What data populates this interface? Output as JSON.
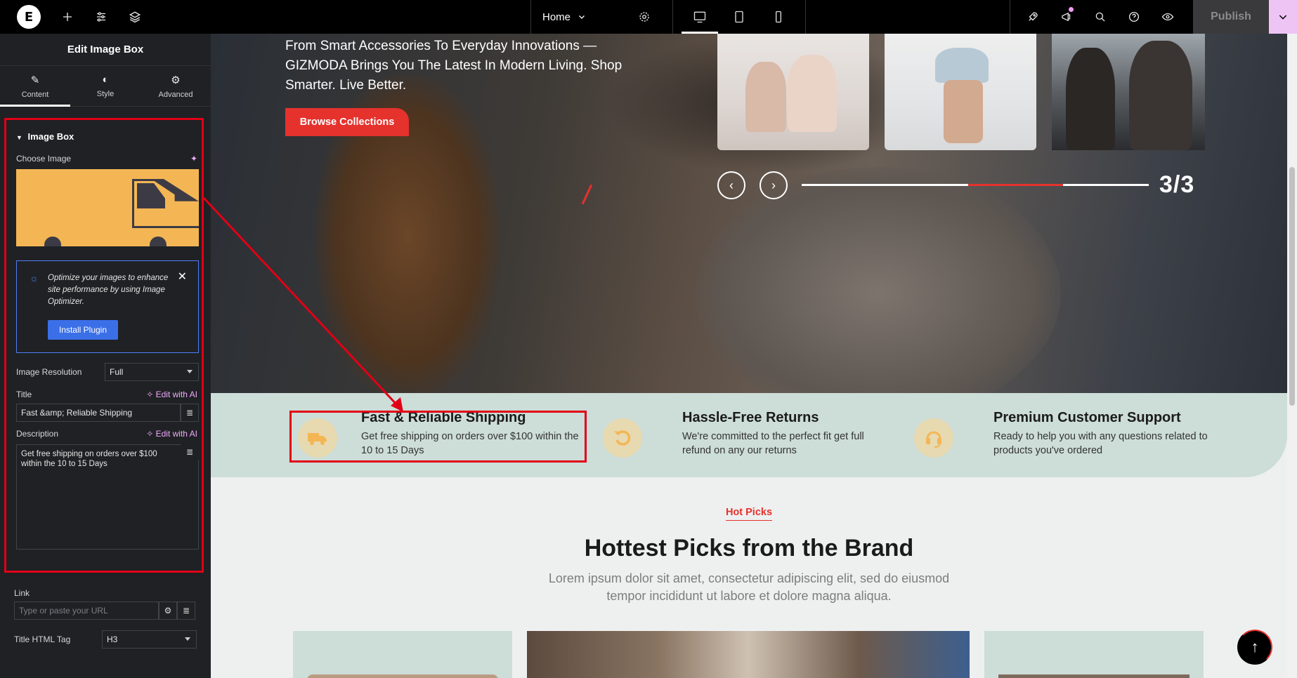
{
  "topbar": {
    "logo_letter": "E",
    "page_name": "Home",
    "publish_label": "Publish",
    "icons": [
      "elementor-logo-icon",
      "add-icon",
      "settings-sliders-icon",
      "layers-icon",
      "page-settings-gear-icon",
      "desktop-icon",
      "tablet-icon",
      "mobile-icon",
      "rocket-icon",
      "megaphone-icon",
      "search-icon",
      "help-icon",
      "preview-eye-icon",
      "chevron-down-icon"
    ]
  },
  "panel": {
    "title": "Edit Image Box",
    "tabs": [
      {
        "label": "Content",
        "icon": "pencil-icon"
      },
      {
        "label": "Style",
        "icon": "contrast-icon"
      },
      {
        "label": "Advanced",
        "icon": "gear-icon"
      }
    ],
    "section_title": "Image Box",
    "choose_image_label": "Choose Image",
    "notice": {
      "message": "Optimize your images to enhance site performance by using Image Optimizer.",
      "button_label": "Install Plugin"
    },
    "image_resolution": {
      "label": "Image Resolution",
      "value": "Full"
    },
    "title_field": {
      "label": "Title",
      "ai_label": "Edit with AI",
      "value": "Fast &amp; Reliable Shipping"
    },
    "description_field": {
      "label": "Description",
      "ai_label": "Edit with AI",
      "value": "Get free shipping on orders over $100 within the 10 to 15 Days"
    },
    "link_field": {
      "label": "Link",
      "placeholder": "Type or paste your URL"
    },
    "title_tag": {
      "label": "Title HTML Tag",
      "value": "H3"
    }
  },
  "hero": {
    "text": "From Smart Accessories To Everyday Innovations —GIZMODA Brings You The Latest In Modern Living. Shop Smarter. Live Better.",
    "button_label": "Browse Collections",
    "slide_counter": "3/3",
    "slider_progress": 0.33
  },
  "features": [
    {
      "title": "Fast & Reliable Shipping",
      "desc": "Get free shipping on orders over $100 within the 10 to 15 Days",
      "icon": "truck-icon"
    },
    {
      "title": "Hassle-Free Returns",
      "desc": "We're committed to the perfect fit get full refund on any our returns",
      "icon": "return-arrow-icon"
    },
    {
      "title": "Premium Customer Support",
      "desc": "Ready to help you with any questions related to products you've ordered",
      "icon": "headset-icon"
    }
  ],
  "hot_picks": {
    "tag": "Hot Picks",
    "title": "Hottest Picks from the Brand",
    "desc_line1": "Lorem ipsum dolor sit amet, consectetur adipiscing elit, sed do eiusmod",
    "desc_line2": "tempor incididunt ut labore et dolore magna aliqua."
  },
  "colors": {
    "accent": "#e5322d",
    "annotation": "#e10016",
    "feature_bg": "#cdddd8",
    "panel_bg": "#1f2124",
    "ai_link": "#f0abfc"
  }
}
